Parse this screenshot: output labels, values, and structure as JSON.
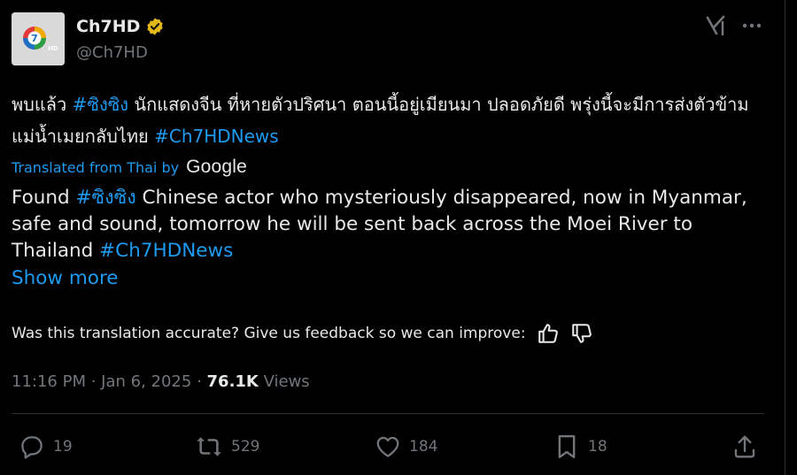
{
  "account": {
    "name": "Ch7HD",
    "handle": "@Ch7HD"
  },
  "tweet": {
    "original_parts": [
      {
        "text": "พบแล้ว ",
        "type": "text"
      },
      {
        "text": "#ซิงซิง",
        "type": "hashtag"
      },
      {
        "text": " นักแสดงจีน ที่หายตัวปริศนา ตอนนี้อยู่เมียนมา ปลอดภัยดี พรุ่งนี้จะมีการส่งตัวข้ามแม่น้ำเมยกลับไทย ",
        "type": "text"
      },
      {
        "text": "#Ch7HDNews",
        "type": "hashtag"
      }
    ],
    "translated_label": "Translated from Thai by",
    "translator_brand": "Google",
    "translation_parts": [
      {
        "text": "Found ",
        "type": "text"
      },
      {
        "text": "#ซิงซิง",
        "type": "hashtag"
      },
      {
        "text": " Chinese actor who mysteriously disappeared, now in Myanmar, safe and sound, tomorrow he will be sent back across the Moei River to Thailand ",
        "type": "text"
      },
      {
        "text": "#Ch7HDNews",
        "type": "hashtag"
      }
    ],
    "show_more": "Show more",
    "feedback_prompt": "Was this translation accurate? Give us feedback so we can improve:"
  },
  "meta": {
    "time": "11:16 PM",
    "separator": " · ",
    "date": "Jan 6, 2025",
    "views_count": "76.1K",
    "views_label": " Views"
  },
  "actions": {
    "replies": "19",
    "reposts": "529",
    "likes": "184",
    "bookmarks": "18"
  },
  "colors": {
    "background": "#000000",
    "text": "#e7e9ea",
    "secondary": "#71767b",
    "accent": "#1d9bf0",
    "verified": "#e2b719",
    "divider": "#2f3336"
  },
  "icons": [
    "verified-badge-icon",
    "grok-icon",
    "more-icon",
    "thumbs-up-icon",
    "thumbs-down-icon",
    "reply-icon",
    "repost-icon",
    "like-icon",
    "bookmark-icon",
    "share-icon"
  ]
}
